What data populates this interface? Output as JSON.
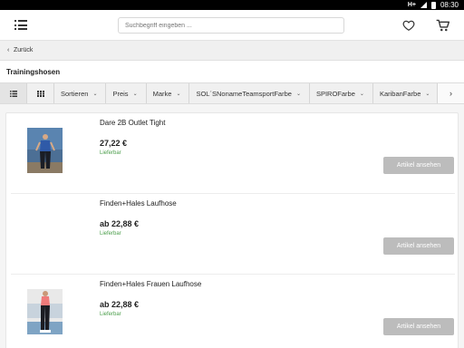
{
  "status_bar": {
    "network": "H+",
    "time": "08:30"
  },
  "header": {
    "search_placeholder": "Suchbegriff eingeben ..."
  },
  "back": {
    "label": "Zurück"
  },
  "page": {
    "title": "Trainingshosen"
  },
  "filters": [
    {
      "label": "Sortieren"
    },
    {
      "label": "Preis"
    },
    {
      "label": "Marke"
    },
    {
      "label": "SOL´SNonameTeamsportFarbe"
    },
    {
      "label": "SPIROFarbe"
    },
    {
      "label": "KaribanFarbe"
    }
  ],
  "products": [
    {
      "name": "Dare 2B Outlet Tight",
      "price": "27,22 €",
      "stock": "Lieferbar",
      "button": "Artikel ansehen",
      "image": "runner-in-blue-tights"
    },
    {
      "name": "Finden+Hales Laufhose",
      "price": "ab 22,88 €",
      "stock": "Lieferbar",
      "button": "Artikel ansehen",
      "image": "none"
    },
    {
      "name": "Finden+Hales Frauen Laufhose",
      "price": "ab 22,88 €",
      "stock": "Lieferbar",
      "button": "Artikel ansehen",
      "image": "woman-in-black-running-pants"
    }
  ],
  "colors": {
    "stock_green": "#4a9d4a",
    "button_gray": "#bcbcbc"
  }
}
